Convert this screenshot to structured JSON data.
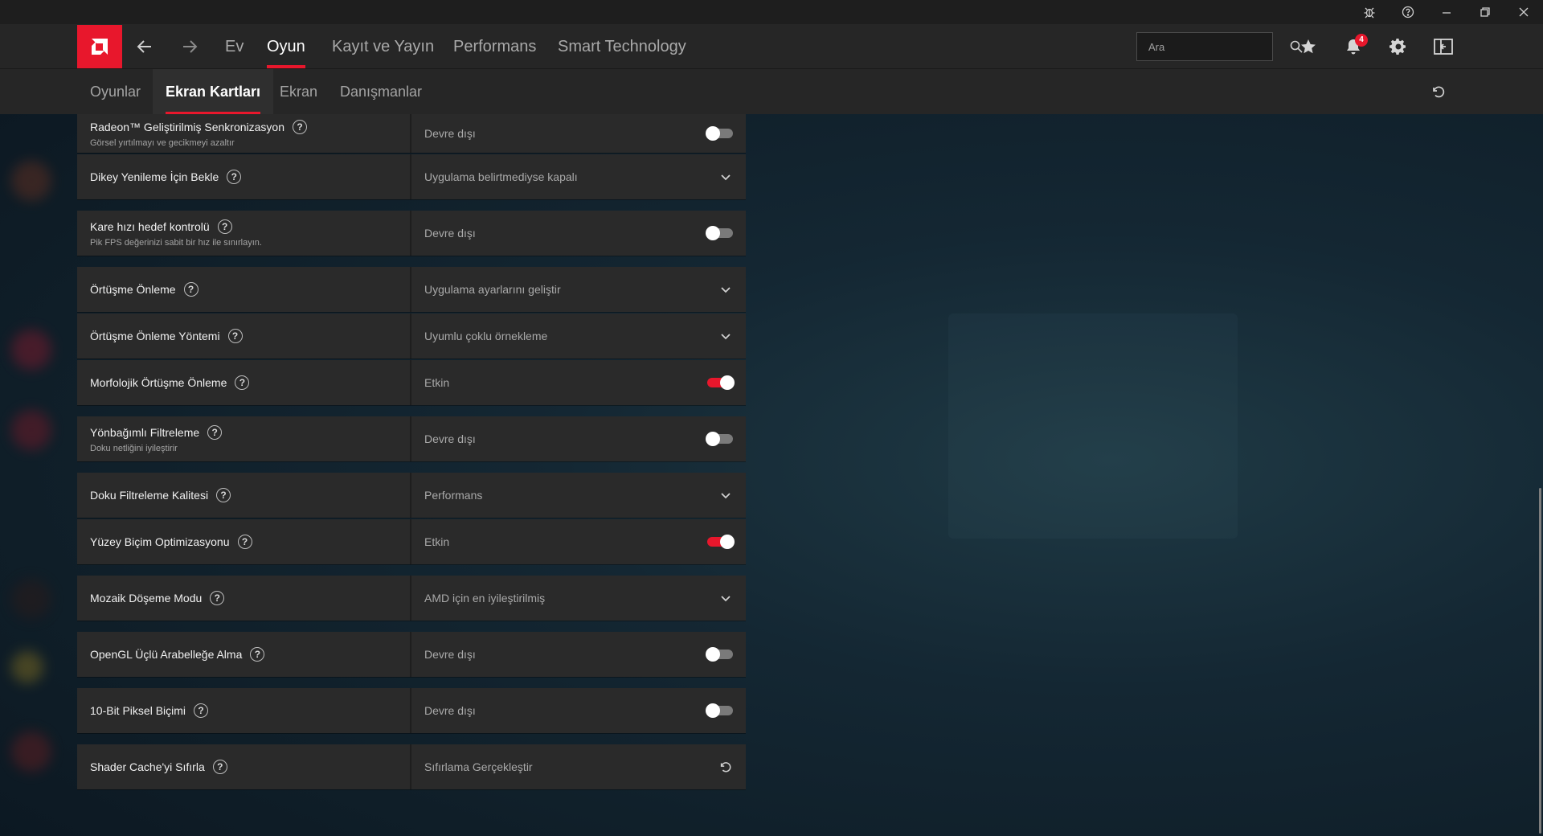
{
  "window": {
    "controls": [
      "bug-icon",
      "help-icon",
      "minimize-icon",
      "restore-icon",
      "close-icon"
    ]
  },
  "nav": {
    "links": [
      {
        "label": "Ev",
        "active": false
      },
      {
        "label": "Oyun",
        "active": true
      },
      {
        "label": "Kayıt ve Yayın",
        "active": false
      },
      {
        "label": "Performans",
        "active": false
      },
      {
        "label": "Smart Technology",
        "active": false
      }
    ],
    "search_placeholder": "Ara",
    "notification_count": "4"
  },
  "subnav": {
    "tabs": [
      {
        "label": "Oyunlar",
        "active": false
      },
      {
        "label": "Ekran Kartları",
        "active": true
      },
      {
        "label": "Ekran",
        "active": false
      },
      {
        "label": "Danışmanlar",
        "active": false
      }
    ]
  },
  "settings": [
    {
      "rows": [
        {
          "label": "Radeon™ Geliştirilmiş Senkronizasyon",
          "desc": "Görsel yırtılmayı ve gecikmeyi azaltır",
          "value": "Devre dışı",
          "control": "toggle",
          "on": false
        },
        {
          "label": "Dikey Yenileme İçin Bekle",
          "desc": "",
          "value": "Uygulama belirtmediyse kapalı",
          "control": "dropdown"
        }
      ]
    },
    {
      "rows": [
        {
          "label": "Kare hızı hedef kontrolü",
          "desc": "Pik FPS değerinizi sabit bir hız ile sınırlayın.",
          "value": "Devre dışı",
          "control": "toggle",
          "on": false
        }
      ]
    },
    {
      "rows": [
        {
          "label": "Örtüşme Önleme",
          "desc": "",
          "value": "Uygulama ayarlarını geliştir",
          "control": "dropdown"
        },
        {
          "label": "Örtüşme Önleme Yöntemi",
          "desc": "",
          "value": "Uyumlu çoklu örnekleme",
          "control": "dropdown"
        },
        {
          "label": "Morfolojik Örtüşme Önleme",
          "desc": "",
          "value": "Etkin",
          "control": "toggle",
          "on": true
        }
      ]
    },
    {
      "rows": [
        {
          "label": "Yönbağımlı Filtreleme",
          "desc": "Doku netliğini iyileştirir",
          "value": "Devre dışı",
          "control": "toggle",
          "on": false
        }
      ]
    },
    {
      "rows": [
        {
          "label": "Doku Filtreleme Kalitesi",
          "desc": "",
          "value": "Performans",
          "control": "dropdown"
        },
        {
          "label": "Yüzey Biçim Optimizasyonu",
          "desc": "",
          "value": "Etkin",
          "control": "toggle",
          "on": true
        }
      ]
    },
    {
      "rows": [
        {
          "label": "Mozaik Döşeme Modu",
          "desc": "",
          "value": "AMD için en iyileştirilmiş",
          "control": "dropdown"
        }
      ]
    },
    {
      "rows": [
        {
          "label": "OpenGL Üçlü Arabelleğe Alma",
          "desc": "",
          "value": "Devre dışı",
          "control": "toggle",
          "on": false
        }
      ]
    },
    {
      "rows": [
        {
          "label": "10-Bit Piksel Biçimi",
          "desc": "",
          "value": "Devre dışı",
          "control": "toggle",
          "on": false
        }
      ]
    },
    {
      "rows": [
        {
          "label": "Shader Cache'yi Sıfırla",
          "desc": "",
          "value": "Sıfırlama Gerçekleştir",
          "control": "reset"
        }
      ]
    }
  ],
  "colors": {
    "accent": "#e8172c",
    "row_bg": "#2a2a2a",
    "nav_bg": "#262626"
  }
}
